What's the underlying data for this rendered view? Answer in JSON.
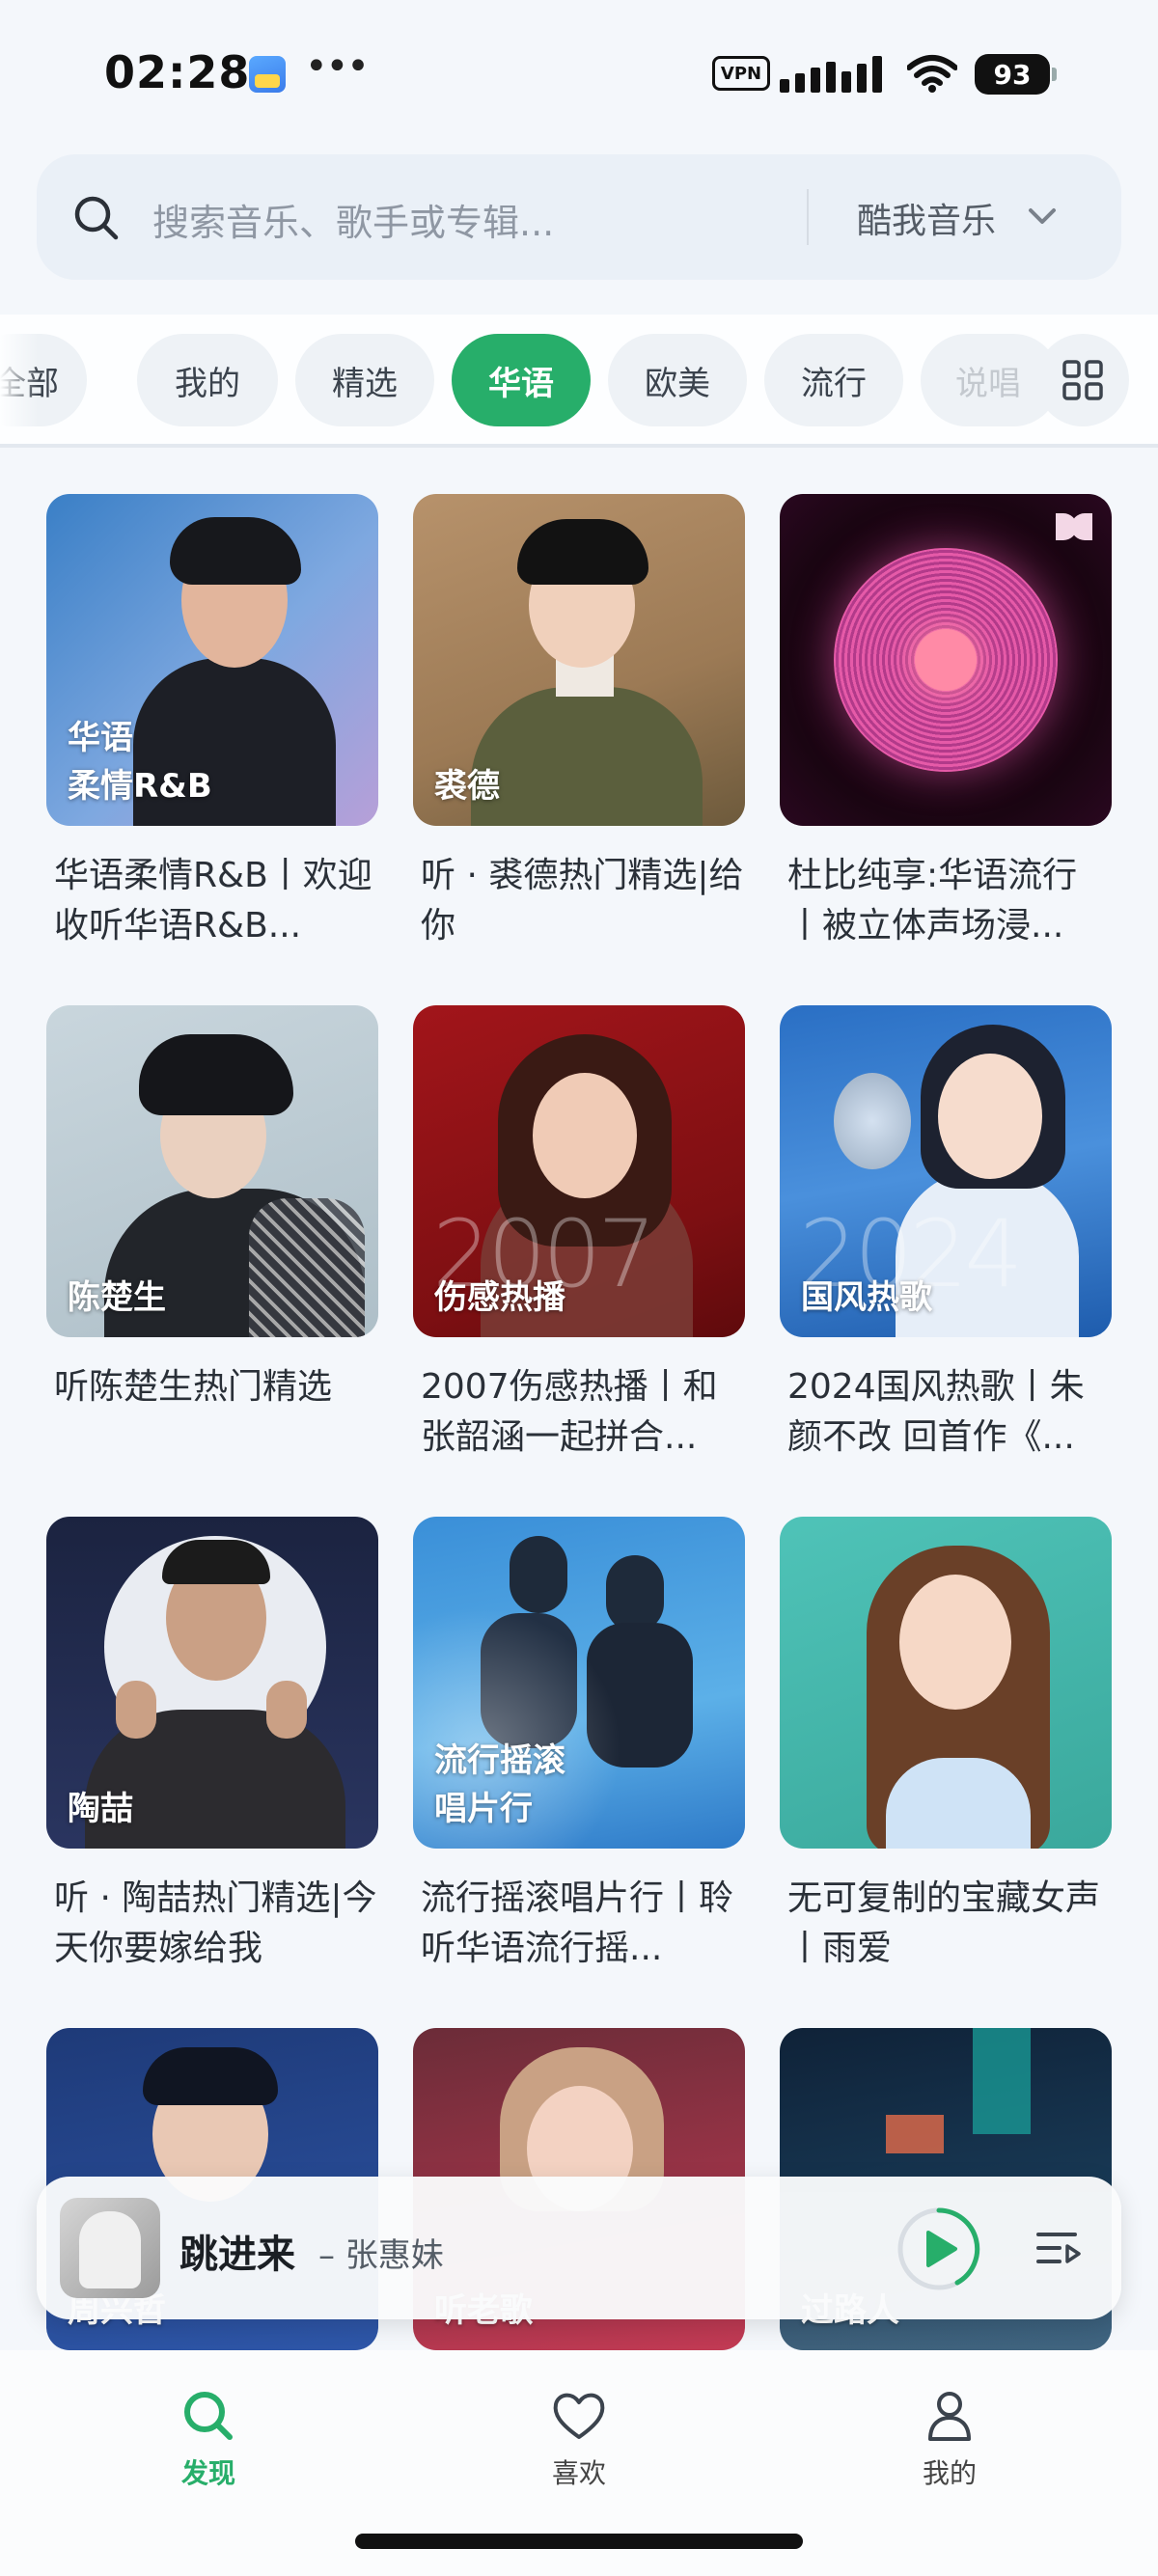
{
  "status_bar": {
    "time": "02:28",
    "vpn": "VPN",
    "battery": "93"
  },
  "search": {
    "placeholder": "搜索音乐、歌手或专辑...",
    "source": "酷我音乐"
  },
  "tabs": [
    {
      "label": "全部"
    },
    {
      "label": "我的"
    },
    {
      "label": "精选"
    },
    {
      "label": "华语",
      "active": true
    },
    {
      "label": "欧美"
    },
    {
      "label": "流行"
    },
    {
      "label": "说唱"
    }
  ],
  "playlists": [
    {
      "overlay": [
        "华语",
        "柔情R&B"
      ],
      "title": "华语柔情R&B丨欢迎收听华语R&B..."
    },
    {
      "overlay": [
        "裘德"
      ],
      "title": "听 · 裘德热门精选|给你"
    },
    {
      "overlay": [],
      "title": "杜比纯享:华语流行丨被立体声场浸..."
    },
    {
      "overlay": [
        "陈楚生"
      ],
      "title": "听陈楚生热门精选"
    },
    {
      "overlay": [
        "伤感热播"
      ],
      "big": "2007",
      "title": "2007伤感热播丨和张韶涵一起拼合..."
    },
    {
      "overlay": [
        "国风热歌"
      ],
      "big": "2024",
      "title": "2024国风热歌丨朱颜不改 回首作《..."
    },
    {
      "overlay": [
        "陶喆"
      ],
      "title": "听 · 陶喆热门精选|今天你要嫁给我"
    },
    {
      "overlay": [
        "流行摇滚",
        "唱片行"
      ],
      "title": "流行摇滚唱片行丨聆听华语流行摇..."
    },
    {
      "overlay": [],
      "title": "无可复制的宝藏女声丨雨爱"
    },
    {
      "overlay": [
        "周兴哲"
      ],
      "title": ""
    },
    {
      "overlay": [
        "听老歌"
      ],
      "title": ""
    },
    {
      "overlay": [
        "过路人"
      ],
      "title": ""
    }
  ],
  "player": {
    "song": "跳进来",
    "artist": "– 张惠妹"
  },
  "nav": [
    {
      "label": "发现",
      "active": true
    },
    {
      "label": "喜欢"
    },
    {
      "label": "我的"
    }
  ],
  "colors": {
    "accent": "#27ae6a",
    "background": "#f4f7fb"
  },
  "icons": [
    "search-icon",
    "chevron-down-icon",
    "grid-icon",
    "dolby-icon",
    "play-icon",
    "playlist-icon",
    "discover-icon",
    "heart-icon",
    "user-icon"
  ]
}
